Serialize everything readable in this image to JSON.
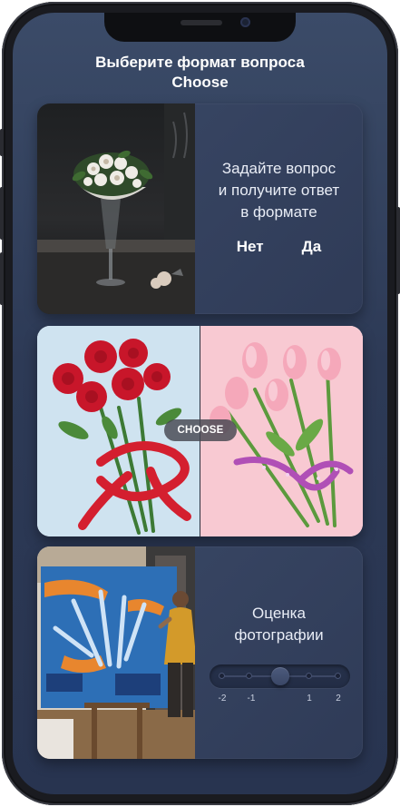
{
  "header": {
    "line1": "Выберите формат вопроса",
    "line2": "Choose"
  },
  "yes_no_card": {
    "question": [
      "Задайте вопрос",
      "и получите ответ",
      "в формате"
    ],
    "answers": [
      "Нет",
      "Да"
    ]
  },
  "choose_card": {
    "badge": "CHOOSE"
  },
  "rating_card": {
    "title": [
      "Оценка",
      "фотографии"
    ],
    "scale": [
      "-2",
      "-1",
      "1",
      "2"
    ],
    "selected_value": 0
  },
  "colors": {
    "screen_top": "#3b4b68",
    "screen_bottom": "#283450",
    "card": "#34425f",
    "text": "#ffffff"
  }
}
